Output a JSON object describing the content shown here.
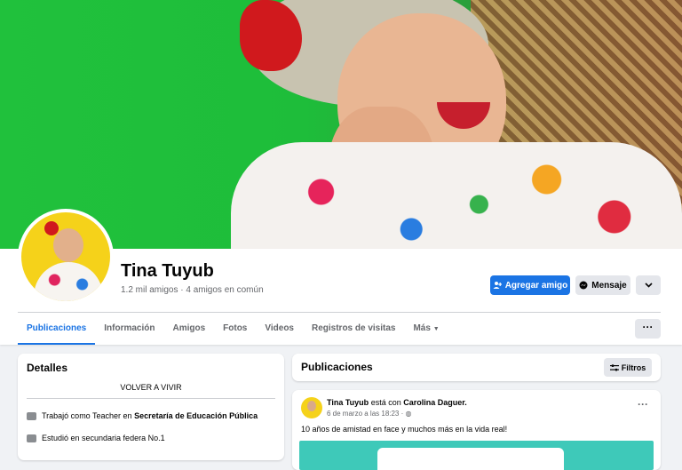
{
  "profile": {
    "name": "Tina Tuyub",
    "friends_text": "1.2 mil amigos · 4 amigos en común"
  },
  "actions": {
    "add_friend": "Agregar amigo",
    "message": "Mensaje"
  },
  "tabs": [
    {
      "label": "Publicaciones"
    },
    {
      "label": "Información"
    },
    {
      "label": "Amigos"
    },
    {
      "label": "Fotos"
    },
    {
      "label": "Videos"
    },
    {
      "label": "Registros de visitas"
    },
    {
      "label": "Más"
    }
  ],
  "details": {
    "title": "Detalles",
    "bio": "VOLVER A VIVIR",
    "work_prefix": "Trabajó como Teacher en",
    "work_place": "Secretaría de Educación Pública",
    "study": "Estudió en secundaria federa No.1"
  },
  "publications": {
    "title": "Publicaciones",
    "filters": "Filtros"
  },
  "post": {
    "author": "Tina Tuyub",
    "with_text": "está con",
    "tagged": "Carolina Daguer.",
    "meta": "6 de marzo a las 18:23 ·",
    "text": "10 años de amistad en face y muchos más en la vida real!"
  },
  "colors": {
    "accent": "#1b74e4",
    "background": "#f0f2f5"
  }
}
